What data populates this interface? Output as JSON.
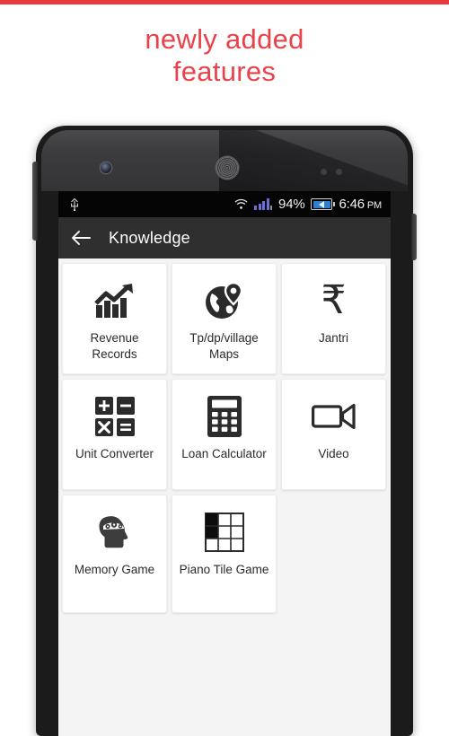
{
  "promo": {
    "line1": "newly added",
    "line2": "features",
    "color": "#e8434a"
  },
  "top_rule_color": "#e8393f",
  "phone": {
    "hardware": {
      "camera": "front-camera",
      "speaker": "earpiece-speaker",
      "sensors": "proximity-sensors",
      "volume_button": "volume-rocker",
      "power_button": "power-button"
    }
  },
  "statusbar": {
    "usb_icon": "usb-icon",
    "wifi_icon": "wifi-icon",
    "signal_icon": "cellular-signal-icon",
    "signal_color": "#6d6fd6",
    "battery_percent": "94%",
    "battery_icon": "battery-charging-icon",
    "battery_color": "#2f7fd1",
    "time": "6:46",
    "ampm": "PM"
  },
  "appbar": {
    "back_icon": "arrow-left-icon",
    "title": "Knowledge",
    "background": "#2f2f2f"
  },
  "grid": {
    "tiles": [
      {
        "label": "Revenue Records",
        "icon": "chart-growth-icon"
      },
      {
        "label": "Tp/dp/village Maps",
        "icon": "globe-map-pin-icon"
      },
      {
        "label": "Jantri",
        "icon": "rupee-icon"
      },
      {
        "label": "Unit Converter",
        "icon": "math-operators-icon"
      },
      {
        "label": "Loan Calculator",
        "icon": "calculator-icon"
      },
      {
        "label": "Video",
        "icon": "video-camera-icon"
      },
      {
        "label": "Memory Game",
        "icon": "head-gears-icon"
      },
      {
        "label": "Piano Tile Game",
        "icon": "tile-grid-icon"
      }
    ]
  }
}
